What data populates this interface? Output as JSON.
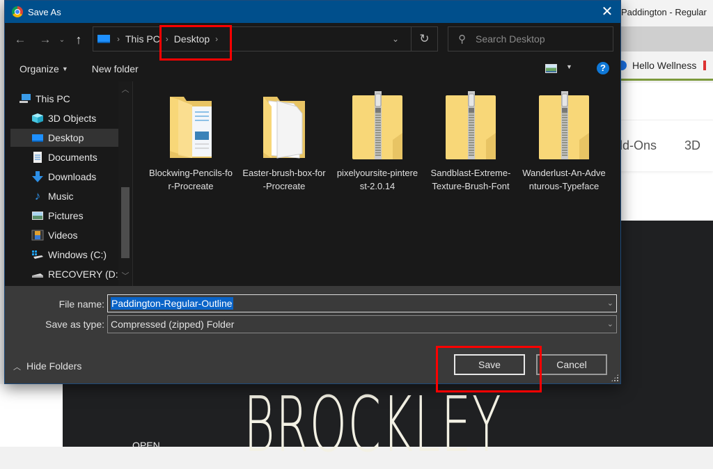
{
  "background": {
    "browser_tab_title": "Paddington - Regular",
    "bookmark_label": "Hello Wellness",
    "nav_items": [
      "dd-Ons",
      "3D"
    ],
    "hero_text": "BROCKLEY",
    "small_text": "OPEN"
  },
  "dialog": {
    "title": "Save As",
    "close_glyph": "✕",
    "nav": {
      "back_glyph": "←",
      "forward_glyph": "→",
      "recent_glyph": "⌄",
      "up_glyph": "↑"
    },
    "address": {
      "crumbs": [
        "This PC",
        "Desktop"
      ],
      "sep_glyph": "›",
      "dropdown_glyph": "⌄",
      "refresh_glyph": "↻"
    },
    "search": {
      "placeholder": "Search Desktop",
      "icon_glyph": "⚲"
    },
    "toolbar": {
      "organize_label": "Organize",
      "caret_glyph": "▼",
      "new_folder_label": "New folder",
      "help_glyph": "?"
    },
    "sidebar": {
      "items": [
        {
          "label": "This PC",
          "icon": "computer-icon"
        },
        {
          "label": "3D Objects",
          "icon": "cube-icon"
        },
        {
          "label": "Desktop",
          "icon": "desktop-icon",
          "selected": true
        },
        {
          "label": "Documents",
          "icon": "document-icon"
        },
        {
          "label": "Downloads",
          "icon": "download-icon"
        },
        {
          "label": "Music",
          "icon": "music-icon"
        },
        {
          "label": "Pictures",
          "icon": "pictures-icon"
        },
        {
          "label": "Videos",
          "icon": "videos-icon"
        },
        {
          "label": "Windows (C:)",
          "icon": "drive-icon"
        },
        {
          "label": "RECOVERY (D:)",
          "icon": "drive-icon"
        }
      ],
      "scroll_up_glyph": "︿",
      "scroll_down_glyph": "﹀"
    },
    "files": [
      {
        "label": "Blockwing-Pencils-for-Procreate",
        "type": "folder-documents"
      },
      {
        "label": "Easter-brush-box-for-Procreate",
        "type": "folder-papers"
      },
      {
        "label": "pixelyoursite-pinterest-2.0.14",
        "type": "zip-folder"
      },
      {
        "label": "Sandblast-Extreme-Texture-Brush-Font",
        "type": "zip-folder"
      },
      {
        "label": "Wanderlust-An-Adventurous-Typeface",
        "type": "zip-folder"
      }
    ],
    "form": {
      "file_name_label": "File name:",
      "file_name_value": "Paddington-Regular-Outline",
      "save_type_label": "Save as type:",
      "save_type_value": "Compressed (zipped) Folder",
      "dropdown_glyph": "⌄"
    },
    "hide_folders_label": "Hide Folders",
    "hide_folders_glyph": "︿",
    "save_label": "Save",
    "cancel_label": "Cancel"
  },
  "annotations": {
    "highlight_color": "#ff0000"
  }
}
